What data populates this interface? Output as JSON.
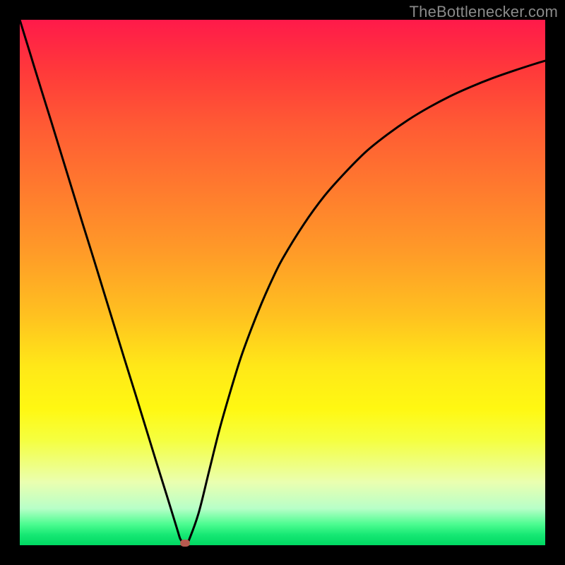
{
  "watermark": {
    "text": "TheBottlenecker.com"
  },
  "chart_data": {
    "type": "line",
    "x": [
      0.0,
      0.02,
      0.04,
      0.06,
      0.08,
      0.1,
      0.12,
      0.14,
      0.16,
      0.18,
      0.2,
      0.22,
      0.24,
      0.26,
      0.28,
      0.3,
      0.305,
      0.31,
      0.315,
      0.32,
      0.34,
      0.36,
      0.38,
      0.4,
      0.42,
      0.44,
      0.46,
      0.48,
      0.5,
      0.54,
      0.58,
      0.62,
      0.66,
      0.7,
      0.74,
      0.78,
      0.82,
      0.86,
      0.9,
      0.94,
      0.98,
      1.0
    ],
    "values": [
      1.0,
      0.935,
      0.87,
      0.806,
      0.741,
      0.676,
      0.611,
      0.547,
      0.482,
      0.417,
      0.352,
      0.288,
      0.223,
      0.158,
      0.094,
      0.029,
      0.013,
      0.005,
      0.0,
      0.005,
      0.06,
      0.14,
      0.22,
      0.29,
      0.355,
      0.41,
      0.46,
      0.505,
      0.545,
      0.61,
      0.665,
      0.71,
      0.75,
      0.782,
      0.81,
      0.834,
      0.855,
      0.873,
      0.889,
      0.903,
      0.916,
      0.922
    ],
    "title": "",
    "xlabel": "",
    "ylabel": "",
    "xlim": [
      0,
      1
    ],
    "ylim": [
      0,
      1
    ],
    "marker": {
      "x": 0.315,
      "y": 0.0
    },
    "gradient_stops": [
      {
        "pos": 0.0,
        "color": "#ff1a4a"
      },
      {
        "pos": 0.5,
        "color": "#ffc020"
      },
      {
        "pos": 0.8,
        "color": "#f5ff40"
      },
      {
        "pos": 1.0,
        "color": "#00d862"
      }
    ]
  },
  "marker_color": "#b85a50",
  "curve_stroke": "#000000",
  "curve_width": 3
}
